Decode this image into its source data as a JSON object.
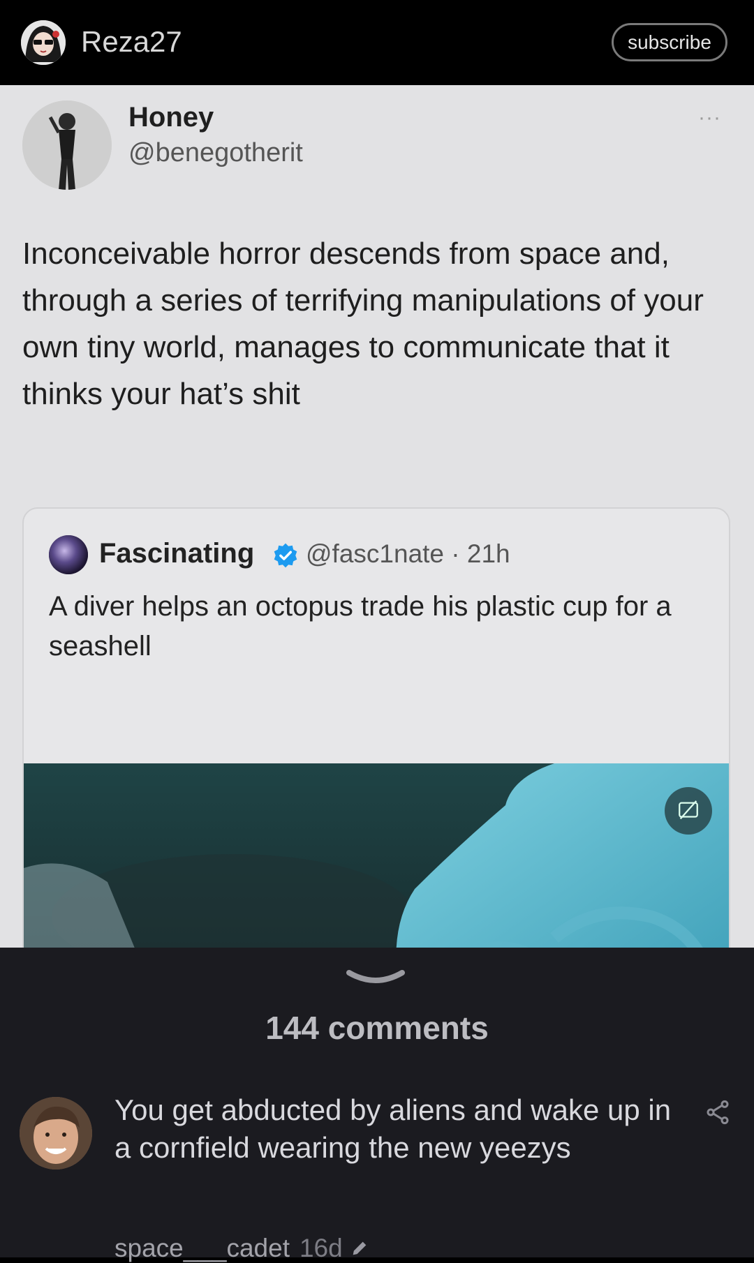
{
  "header": {
    "username": "Reza27",
    "subscribe_label": "subscribe",
    "avatar_icon": "user-avatar-icon"
  },
  "tweet": {
    "author_name": "Honey",
    "author_handle": "@benegotherit",
    "more_label": "···",
    "text": "Inconceivable horror descends from space and, through a series of terrifying manipulations of your own tiny world, manages to communicate that it thinks your hat’s shit",
    "quoted": {
      "author_name": "Fascinating",
      "verified_icon": "verified-badge-icon",
      "handle_time": "@fasc1nate · 21h",
      "text": "A diver helps an octopus trade his plastic cup for a seashell",
      "media_icon": "gif-badge-icon"
    }
  },
  "comments": {
    "count_label": "144 comments",
    "items": [
      {
        "text": "You get abducted by aliens and wake up in a cornfield wearing the new yeezys",
        "author": "space___cadet",
        "age": "16d"
      }
    ]
  },
  "colors": {
    "topbar_bg": "#000000",
    "panel_bg": "#e2e2e4",
    "bottom_bg": "#1b1b20",
    "verified_blue": "#1d9bf0"
  }
}
